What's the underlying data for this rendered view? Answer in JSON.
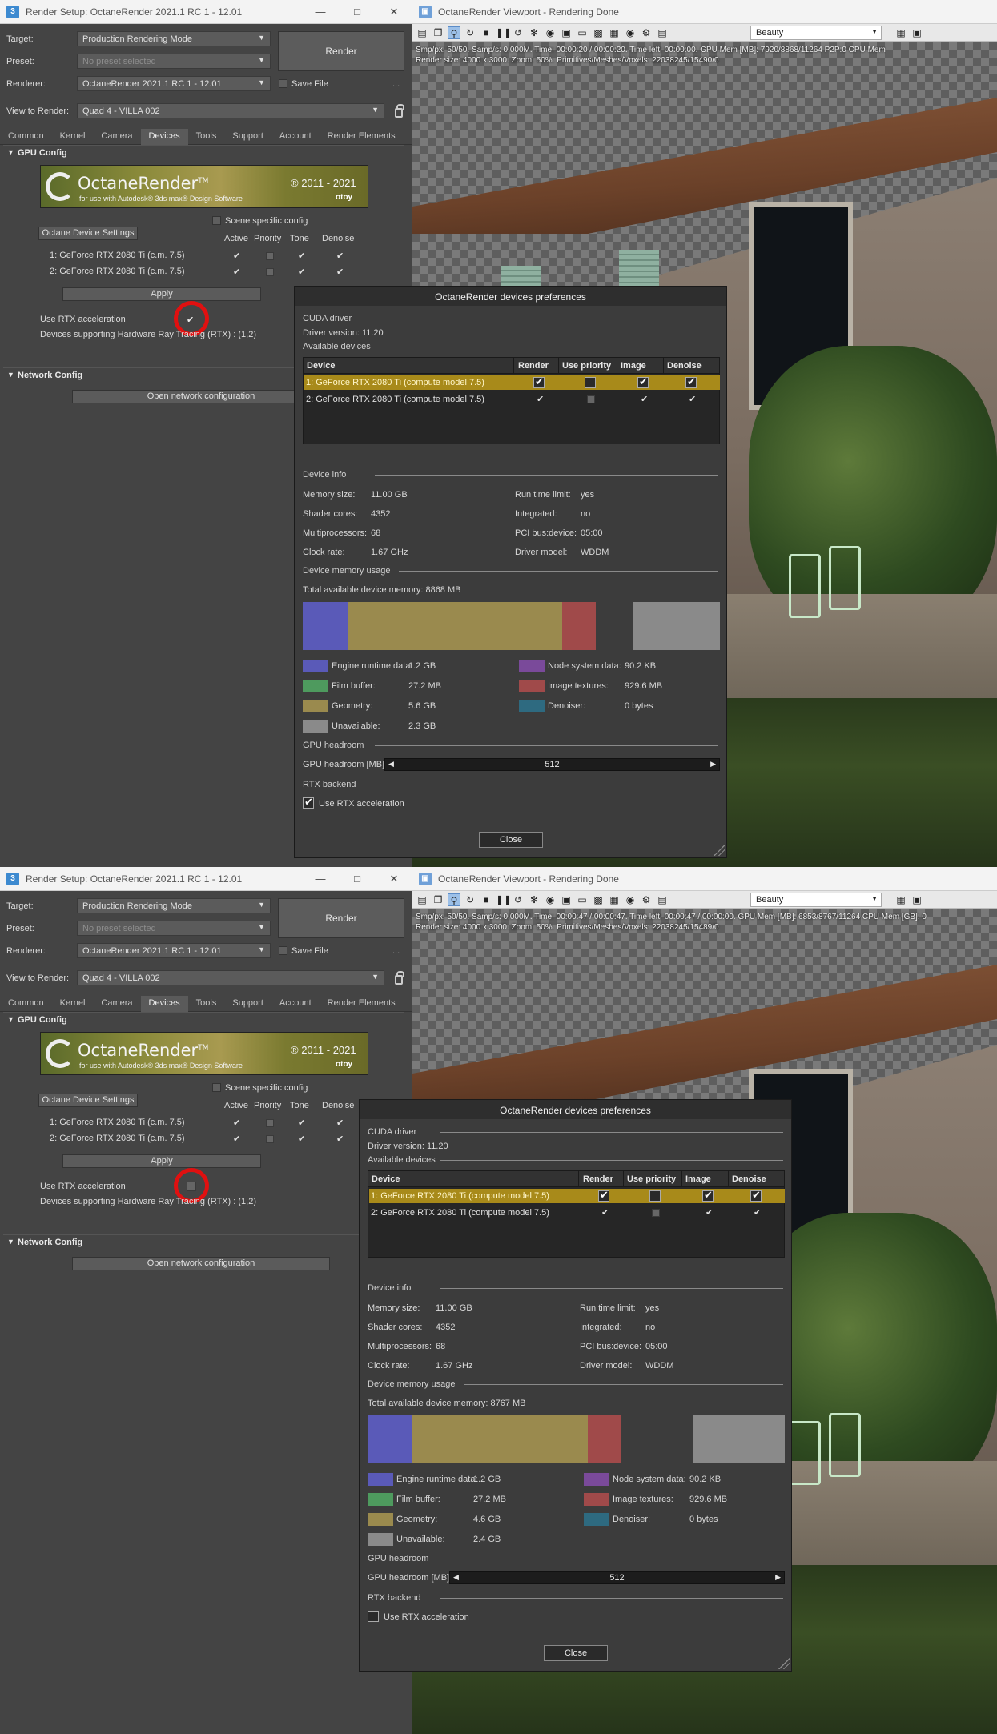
{
  "colors": {
    "engine_runtime": "#5a5ab8",
    "film_buffer": "#4e9a5e",
    "geometry": "#9a8a4e",
    "unavailable": "#8a8a8a",
    "node_system": "#7a4a9a",
    "image_textures": "#a04a4a",
    "denoiser": "#2e6a80",
    "free": "#3c3c3c",
    "selected_row": "#a88a1a",
    "highlight_circle": "#e01010"
  },
  "render_setup": {
    "title": "Render Setup: OctaneRender 2021.1 RC 1 - 12.01",
    "target_label": "Target:",
    "target_value": "Production Rendering Mode",
    "preset_label": "Preset:",
    "preset_value": "No preset selected",
    "renderer_label": "Renderer:",
    "renderer_value": "OctaneRender 2021.1 RC 1 - 12.01",
    "save_file_label": "Save File",
    "more_label": "...",
    "view_label": "View to Render:",
    "view_value": "Quad 4 - VILLA 002",
    "render_button": "Render",
    "tabs": [
      "Common",
      "Kernel",
      "Camera",
      "Devices",
      "Tools",
      "Support",
      "Account",
      "Render Elements"
    ],
    "gpu_config_title": "GPU Config",
    "banner_brand": "OctaneRender",
    "banner_tm": "TM",
    "banner_sub": "for use with Autodesk® 3ds max® Design Software",
    "banner_years": "® 2011 - 2021",
    "banner_otoy": "otoy",
    "scene_specific": "Scene specific config",
    "octane_device_settings": "Octane Device Settings",
    "col_active": "Active",
    "col_priority": "Priority",
    "col_tone": "Tone",
    "col_denoise": "Denoise",
    "devices": [
      "1:  GeForce RTX 2080 Ti (c.m. 7.5)",
      "2:  GeForce RTX 2080 Ti (c.m. 7.5)"
    ],
    "apply": "Apply",
    "use_rtx": "Use RTX acceleration",
    "rtx_support": "Devices supporting Hardware Ray Tracing (RTX) : (1,2)",
    "network_config_title": "Network Config",
    "open_network": "Open network configuration"
  },
  "viewport": {
    "title": "OctaneRender Viewport - Rendering Done",
    "pass_value": "Beauty"
  },
  "shots": [
    {
      "stats_line1": "Smp/px: 50/50.  Samp/s: 0.000M.  Time: 00:00:20 / 00:00:20.  Time left: 00:00:00.  GPU Mem [MB]: 7920/8868/11264 P2P:0   CPU Mem",
      "stats_line2": "Render size: 4000 x 3000.  Zoom: 50%.  Primitives/Meshes/Voxels: 22038245/15490/0",
      "rtx_checked": true,
      "dialog": {
        "title": "OctaneRender devices preferences",
        "cuda_driver": "CUDA driver",
        "driver_version": "Driver version:  11.20",
        "available_devices": "Available devices",
        "col_device": "Device",
        "col_render": "Render",
        "col_use_priority": "Use priority",
        "col_image": "Image",
        "col_denoise": "Denoise",
        "device_rows": [
          "1: GeForce RTX 2080 Ti (compute model 7.5)",
          "2: GeForce RTX 2080 Ti (compute model 7.5)"
        ],
        "device_info": "Device info",
        "memory_size_label": "Memory size:",
        "memory_size": "11.00 GB",
        "shader_cores_label": "Shader cores:",
        "shader_cores": "4352",
        "multiprocessors_label": "Multiprocessors:",
        "multiprocessors": "68",
        "clock_rate_label": "Clock rate:",
        "clock_rate": "1.67 GHz",
        "run_time_limit_label": "Run time limit:",
        "run_time_limit": "yes",
        "integrated_label": "Integrated:",
        "integrated": "no",
        "pci_label": "PCI bus:device:",
        "pci": "05:00",
        "driver_model_label": "Driver model:",
        "driver_model": "WDDM",
        "memory_usage": "Device memory usage",
        "total_available": "Total available device memory:  8868 MB",
        "mem_fractions": {
          "engine": 0.107,
          "geometry": 0.514,
          "textures": 0.082,
          "free": 0.09,
          "unavailable": 0.207
        },
        "legend": {
          "engine_label": "Engine runtime data:",
          "engine_value": "1.2 GB",
          "film_label": "Film buffer:",
          "film_value": "27.2 MB",
          "geometry_label": "Geometry:",
          "geometry_value": "5.6 GB",
          "unavailable_label": "Unavailable:",
          "unavailable_value": "2.3 GB",
          "node_label": "Node system data:",
          "node_value": "90.2 KB",
          "textures_label": "Image textures:",
          "textures_value": "929.6 MB",
          "denoiser_label": "Denoiser:",
          "denoiser_value": "0 bytes"
        },
        "gpu_headroom": "GPU headroom",
        "gpu_headroom_label": "GPU headroom [MB]:",
        "gpu_headroom_value": "512",
        "rtx_backend": "RTX backend",
        "use_rtx": "Use RTX acceleration",
        "use_rtx_checked": true,
        "close": "Close"
      }
    },
    {
      "stats_line1": "Smp/px: 50/50.  Samp/s: 0.000M.  Time: 00:00:47 / 00:00:47.  Time left: 00:00:47 / 00:00:00.  GPU Mem [MB]: 6853/8767/11264  CPU Mem [GB]: 0",
      "stats_line2": "Render size: 4000 x 3000.  Zoom: 50%.  Primitives/Meshes/Voxels: 22038245/15489/0",
      "rtx_checked": false,
      "dialog": {
        "title": "OctaneRender devices preferences",
        "cuda_driver": "CUDA driver",
        "driver_version": "Driver version:  11.20",
        "available_devices": "Available devices",
        "col_device": "Device",
        "col_render": "Render",
        "col_use_priority": "Use priority",
        "col_image": "Image",
        "col_denoise": "Denoise",
        "device_rows": [
          "1: GeForce RTX 2080 Ti (compute model 7.5)",
          "2: GeForce RTX 2080 Ti (compute model 7.5)"
        ],
        "device_info": "Device info",
        "memory_size_label": "Memory size:",
        "memory_size": "11.00 GB",
        "shader_cores_label": "Shader cores:",
        "shader_cores": "4352",
        "multiprocessors_label": "Multiprocessors:",
        "multiprocessors": "68",
        "clock_rate_label": "Clock rate:",
        "clock_rate": "1.67 GHz",
        "run_time_limit_label": "Run time limit:",
        "run_time_limit": "yes",
        "integrated_label": "Integrated:",
        "integrated": "no",
        "pci_label": "PCI bus:device:",
        "pci": "05:00",
        "driver_model_label": "Driver model:",
        "driver_model": "WDDM",
        "memory_usage": "Device memory usage",
        "total_available": "Total available device memory:  8767 MB",
        "mem_fractions": {
          "engine": 0.107,
          "geometry": 0.42,
          "textures": 0.08,
          "free": 0.173,
          "unavailable": 0.22
        },
        "legend": {
          "engine_label": "Engine runtime data:",
          "engine_value": "1.2 GB",
          "film_label": "Film buffer:",
          "film_value": "27.2 MB",
          "geometry_label": "Geometry:",
          "geometry_value": "4.6 GB",
          "unavailable_label": "Unavailable:",
          "unavailable_value": "2.4 GB",
          "node_label": "Node system data:",
          "node_value": "90.2 KB",
          "textures_label": "Image textures:",
          "textures_value": "929.6 MB",
          "denoiser_label": "Denoiser:",
          "denoiser_value": "0 bytes"
        },
        "gpu_headroom": "GPU headroom",
        "gpu_headroom_label": "GPU headroom [MB]:",
        "gpu_headroom_value": "512",
        "rtx_backend": "RTX backend",
        "use_rtx": "Use RTX acceleration",
        "use_rtx_checked": false,
        "close": "Close"
      }
    }
  ]
}
